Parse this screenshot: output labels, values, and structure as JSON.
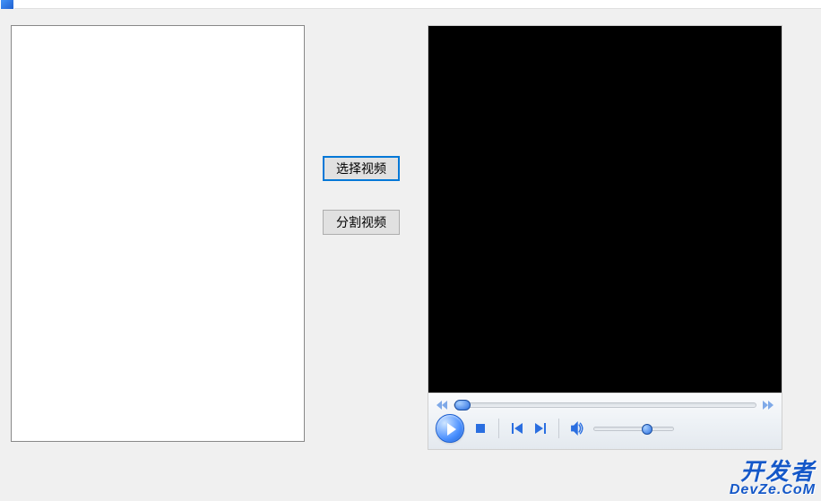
{
  "window": {
    "title": ""
  },
  "buttons": {
    "select_video": "选择视频",
    "split_video": "分割视频"
  },
  "player": {
    "seek_position_percent": 0,
    "volume_percent": 60
  },
  "watermark": {
    "line1": "开发者",
    "line2": "DevZe.CoM"
  }
}
